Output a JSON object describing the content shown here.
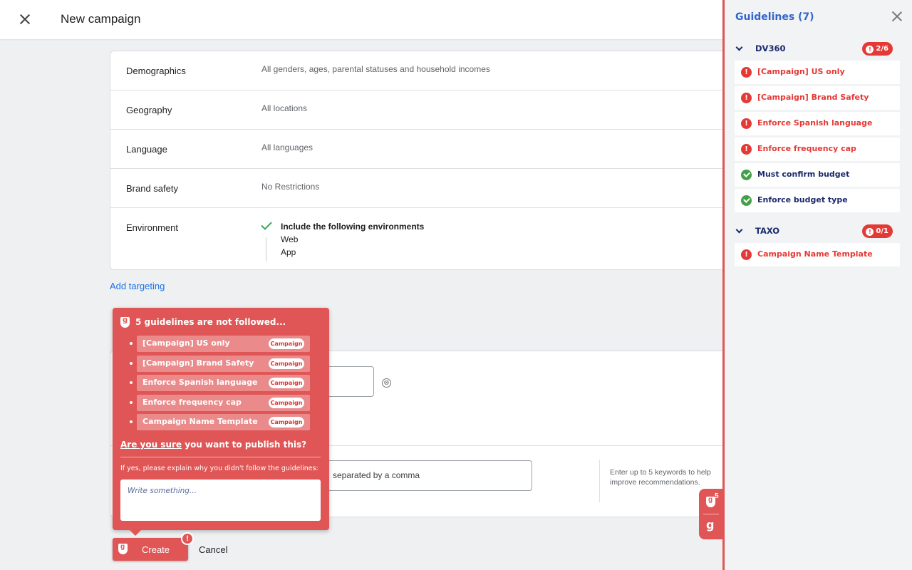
{
  "header": {
    "title": "New campaign"
  },
  "targeting": {
    "rows": [
      {
        "label": "Demographics",
        "value": "All genders, ages, parental statuses and household incomes"
      },
      {
        "label": "Geography",
        "value": "All locations"
      },
      {
        "label": "Language",
        "value": "All languages"
      },
      {
        "label": "Brand safety",
        "value": "No Restrictions"
      }
    ],
    "environment": {
      "label": "Environment",
      "title": "Include the following environments",
      "items": [
        "Web",
        "App"
      ]
    },
    "add_targeting": "Add targeting"
  },
  "keywords": {
    "input_text": "separated by a comma",
    "hint": "Enter up to 5 keywords to help improve recommendations.",
    "clear_icon": "⊗"
  },
  "popup": {
    "title": "5 guidelines are not followed...",
    "items": [
      {
        "label": "[Campaign] US only",
        "tag": "Campaign"
      },
      {
        "label": "[Campaign] Brand Safety",
        "tag": "Campaign"
      },
      {
        "label": "Enforce Spanish language",
        "tag": "Campaign"
      },
      {
        "label": "Enforce frequency cap",
        "tag": "Campaign"
      },
      {
        "label": "Campaign Name Template",
        "tag": "Campaign"
      }
    ],
    "question_link": "Are you sure",
    "question_rest": " you want to publish this?",
    "explain": "If yes, please explain why you didn't follow the guidelines:",
    "placeholder": "Write something..."
  },
  "actions": {
    "create": "Create",
    "cancel": "Cancel",
    "warn": "!"
  },
  "widget": {
    "count": "5",
    "logo": "g"
  },
  "panel": {
    "title": "Guidelines (7)",
    "sections": [
      {
        "name": "DV360",
        "badge": "2/6",
        "items": [
          {
            "label": "[Campaign] US only",
            "status": "error"
          },
          {
            "label": "[Campaign] Brand Safety",
            "status": "error"
          },
          {
            "label": "Enforce Spanish language",
            "status": "error"
          },
          {
            "label": "Enforce frequency cap",
            "status": "error"
          },
          {
            "label": "Must confirm budget",
            "status": "ok"
          },
          {
            "label": "Enforce budget type",
            "status": "ok"
          }
        ]
      },
      {
        "name": "TAXO",
        "badge": "0/1",
        "items": [
          {
            "label": "Campaign Name Template",
            "status": "error"
          }
        ]
      }
    ]
  },
  "colors": {
    "accent_red": "#e05555",
    "error_red": "#e53935",
    "ok_green": "#43a047",
    "link_blue": "#1a73e8",
    "panel_title_blue": "#3366cc"
  }
}
